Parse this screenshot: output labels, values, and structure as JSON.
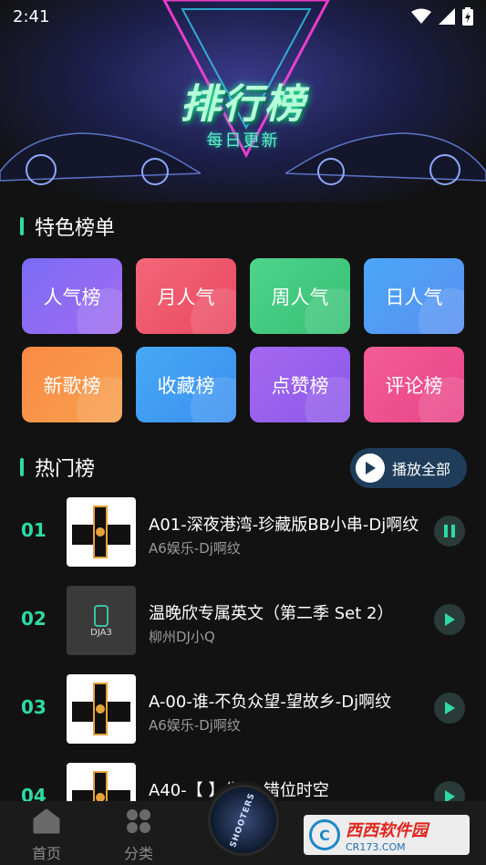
{
  "status": {
    "time": "2:41"
  },
  "hero": {
    "title": "排行榜",
    "subtitle": "每日更新"
  },
  "featured": {
    "heading": "特色榜单",
    "tiles": [
      {
        "label": "人气榜",
        "color_from": "#7a6cf5",
        "color_to": "#a26bf0"
      },
      {
        "label": "月人气",
        "color_from": "#f4677a",
        "color_to": "#e9485f"
      },
      {
        "label": "周人气",
        "color_from": "#4fd38b",
        "color_to": "#38c074"
      },
      {
        "label": "日人气",
        "color_from": "#4aa7f7",
        "color_to": "#5b8ff2"
      },
      {
        "label": "新歌榜",
        "color_from": "#fb8a45",
        "color_to": "#f7a04d"
      },
      {
        "label": "收藏榜",
        "color_from": "#46a9f5",
        "color_to": "#3b8ff0"
      },
      {
        "label": "点赞榜",
        "color_from": "#a468f0",
        "color_to": "#8c58e9"
      },
      {
        "label": "评论榜",
        "color_from": "#f45d96",
        "color_to": "#e84486"
      }
    ]
  },
  "hot": {
    "heading": "热门榜",
    "play_all": "播放全部",
    "songs": [
      {
        "rank": "01",
        "title": "A01-深夜港湾-珍藏版BB小串-Dj啊纹",
        "artist": "A6娱乐-Dj啊纹",
        "cover": "logo",
        "state": "playing"
      },
      {
        "rank": "02",
        "title": "温晚欣专属英文（第二季 Set 2）",
        "artist": "柳州DJ小Q",
        "cover": "dja3",
        "cover_text": "DJA3",
        "state": "paused"
      },
      {
        "rank": "03",
        "title": "A-00-谁-不负众望-望故乡-Dj啊纹",
        "artist": "A6娱乐-Dj啊纹",
        "cover": "logo",
        "state": "paused"
      },
      {
        "rank": "04",
        "title": "A40-【 】像鱼-错位时空",
        "artist": "",
        "cover": "logo",
        "state": "paused"
      }
    ]
  },
  "nav": {
    "items": [
      {
        "label": "首页",
        "icon": "home-icon"
      },
      {
        "label": "分类",
        "icon": "category-icon"
      }
    ],
    "center_label": "SHOOTERS"
  },
  "watermark": {
    "brand": "西西软件园",
    "domain": "CR173.COM",
    "badge": "C"
  },
  "colors": {
    "accent": "#2fd9a4",
    "background": "#121212"
  }
}
